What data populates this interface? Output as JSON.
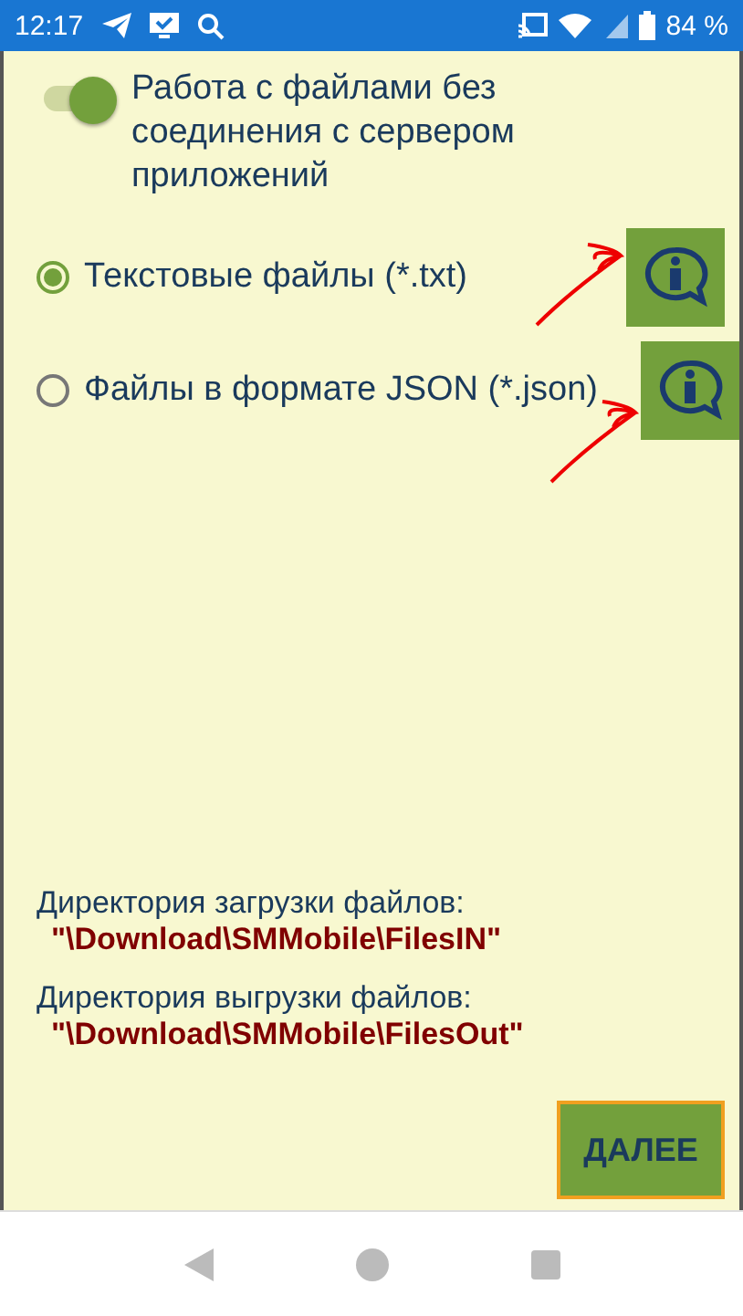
{
  "status_bar": {
    "time": "12:17",
    "battery": "84 %"
  },
  "offline_switch": {
    "label": "Работа с файлами без соединения с сервером приложений",
    "on": true
  },
  "file_formats": [
    {
      "label": "Текстовые файлы (*.txt)",
      "selected": true
    },
    {
      "label": "Файлы в формате JSON (*.json)",
      "selected": false
    }
  ],
  "directories": [
    {
      "label": "Директория загрузки файлов:",
      "path": "\"\\Download\\SMMobile\\FilesIN\""
    },
    {
      "label": "Директория выгрузки файлов:",
      "path": "\"\\Download\\SMMobile\\FilesOut\""
    }
  ],
  "next_button": "ДАЛЕЕ"
}
